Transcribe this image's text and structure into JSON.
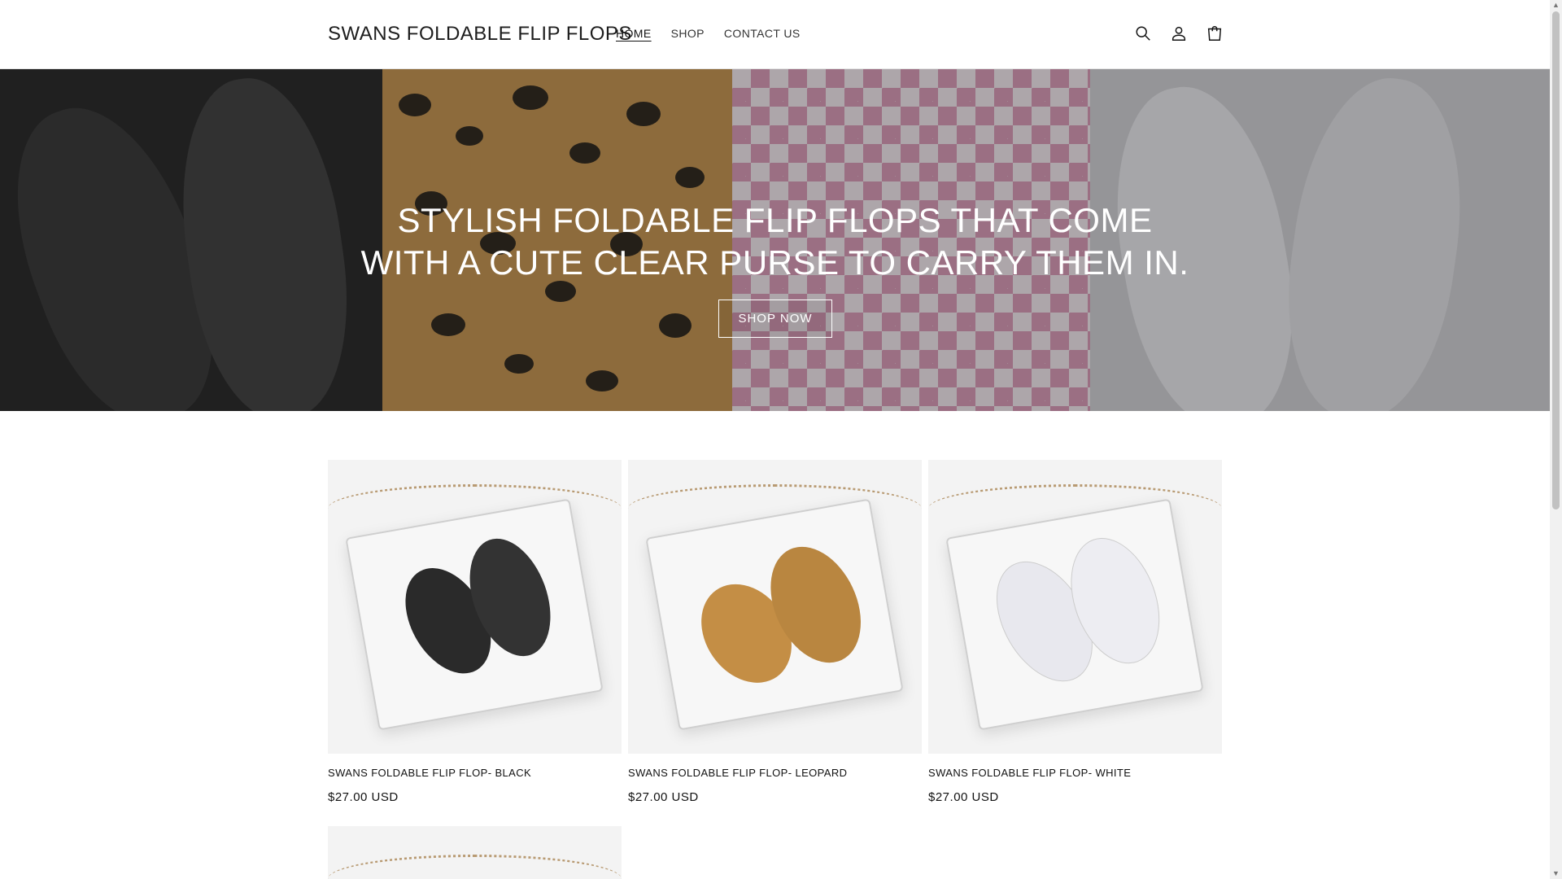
{
  "header": {
    "logo": "SWANS FOLDABLE FLIP FLOPS",
    "nav": [
      "HOME",
      "SHOP",
      "CONTACT US"
    ],
    "active_nav": "HOME",
    "icons": [
      "search-icon",
      "account-icon",
      "cart-icon"
    ]
  },
  "hero": {
    "title_line1": "STYLISH FOLDABLE FLIP FLOPS THAT COME",
    "title_line2": "WITH A CUTE CLEAR PURSE TO CARRY THEM IN.",
    "button_label": "SHOP NOW"
  },
  "products": [
    {
      "title": "SWANS FOLDABLE FLIP FLOP- BLACK",
      "price": "$27.00 USD",
      "flop_color": "#2a2a2a"
    },
    {
      "title": "SWANS FOLDABLE FLIP FLOP- LEOPARD",
      "price": "$27.00 USD",
      "flop_color": "#c48e45"
    },
    {
      "title": "SWANS FOLDABLE FLIP FLOP- WHITE",
      "price": "$27.00 USD",
      "flop_color": "#e8e8ee"
    }
  ],
  "colors": {
    "text": "#121212",
    "hero_text": "#ffffff",
    "card_background": "#f3f3f3"
  }
}
